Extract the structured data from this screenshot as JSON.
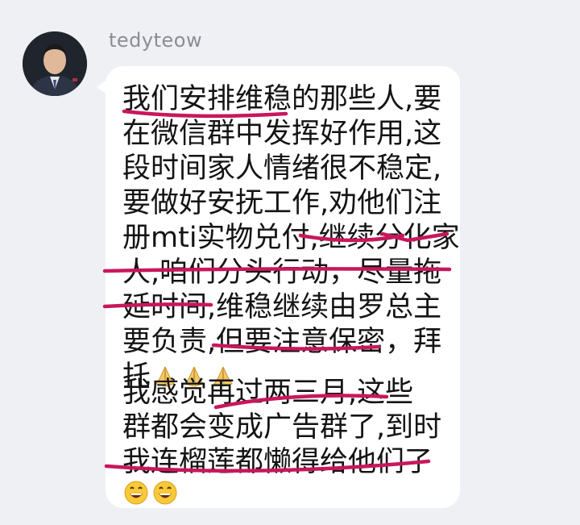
{
  "sender": {
    "name": "tedyteow",
    "avatar": "avatar-photo"
  },
  "message": {
    "lines": [
      "我们安排维稳的那些人,要",
      "在微信群中发挥好作用,这",
      "段时间家人情绪很不稳定,",
      "要做好安抚工作,劝他们注",
      "册mti实物兑付,继续分化家",
      "人,咱们分头行动，尽量拖",
      "延时间,维稳继续由罗总主",
      "要负责,但要注意保密，拜",
      "托",
      "  我感觉再过两三月,这些",
      "群都会变成广告群了,到时",
      "我连榴莲都懒得给他们了"
    ],
    "emoji_praying": "praying-hands-icon",
    "emoji_grin": "grinning-face-icon"
  },
  "annotations": {
    "ink_color": "#c8175d"
  }
}
